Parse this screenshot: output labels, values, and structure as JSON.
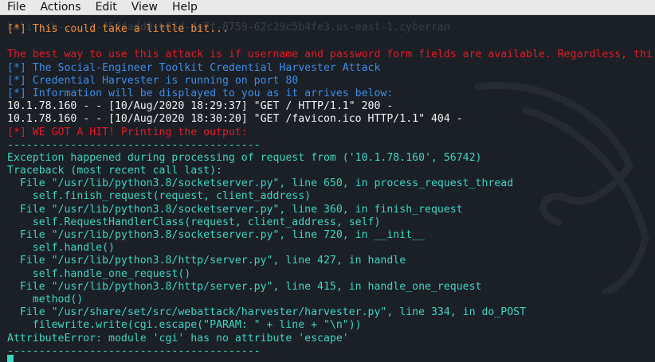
{
  "menu": [
    "File",
    "Actions",
    "Edit",
    "View",
    "Help"
  ],
  "terminal": {
    "ghost_lines": [
      "kali-ssh-...-3-f5ffadd0-b85d-4a7f-8759-62c29c5b4fe3.us-east-1.cyberran"
    ],
    "lines": [
      {
        "text": "[*] This could take a little bit...",
        "color": "orange"
      },
      {
        "text": "",
        "color": "grey"
      },
      {
        "text": "The best way to use this attack is if username and password form fields are available. Regardless, thi",
        "color": "red"
      },
      {
        "text": "[*] The Social-Engineer Toolkit Credential Harvester Attack",
        "color": "blue"
      },
      {
        "text": "[*] Credential Harvester is running on port 80",
        "color": "blue"
      },
      {
        "text": "[*] Information will be displayed to you as it arrives below:",
        "color": "blue"
      },
      {
        "text": "10.1.78.160 - - [10/Aug/2020 18:29:37] \"GET / HTTP/1.1\" 200 -",
        "color": "white"
      },
      {
        "text": "10.1.78.160 - - [10/Aug/2020 18:30:20] \"GET /favicon.ico HTTP/1.1\" 404 -",
        "color": "white"
      },
      {
        "text": "[*] WE GOT A HIT! Printing the output:",
        "color": "red"
      },
      {
        "text": "----------------------------------------",
        "color": "cyan"
      },
      {
        "text": "Exception happened during processing of request from ('10.1.78.160', 56742)",
        "color": "cyan"
      },
      {
        "text": "Traceback (most recent call last):",
        "color": "cyan"
      },
      {
        "text": "  File \"/usr/lib/python3.8/socketserver.py\", line 650, in process_request_thread",
        "color": "cyan"
      },
      {
        "text": "    self.finish_request(request, client_address)",
        "color": "cyan"
      },
      {
        "text": "  File \"/usr/lib/python3.8/socketserver.py\", line 360, in finish_request",
        "color": "cyan"
      },
      {
        "text": "    self.RequestHandlerClass(request, client_address, self)",
        "color": "cyan"
      },
      {
        "text": "  File \"/usr/lib/python3.8/socketserver.py\", line 720, in __init__",
        "color": "cyan"
      },
      {
        "text": "    self.handle()",
        "color": "cyan"
      },
      {
        "text": "  File \"/usr/lib/python3.8/http/server.py\", line 427, in handle",
        "color": "cyan"
      },
      {
        "text": "    self.handle_one_request()",
        "color": "cyan"
      },
      {
        "text": "  File \"/usr/lib/python3.8/http/server.py\", line 415, in handle_one_request",
        "color": "cyan"
      },
      {
        "text": "    method()",
        "color": "cyan"
      },
      {
        "text": "  File \"/usr/share/set/src/webattack/harvester/harvester.py\", line 334, in do_POST",
        "color": "cyan"
      },
      {
        "text": "    filewrite.write(cgi.escape(\"PARAM: \" + line + \"\\n\"))",
        "color": "cyan"
      },
      {
        "text": "AttributeError: module 'cgi' has no attribute 'escape'",
        "color": "cyan"
      },
      {
        "text": "----------------------------------------",
        "color": "cyan"
      }
    ]
  },
  "colors": {
    "background": "#1b1f26",
    "orange": "#f08c36",
    "red": "#e51b29",
    "blue": "#3d8ee8",
    "white": "#f2f2f2",
    "cyan": "#3dd6c1"
  },
  "icons": [
    "kali-dragon-watermark",
    "terminal-cursor"
  ]
}
